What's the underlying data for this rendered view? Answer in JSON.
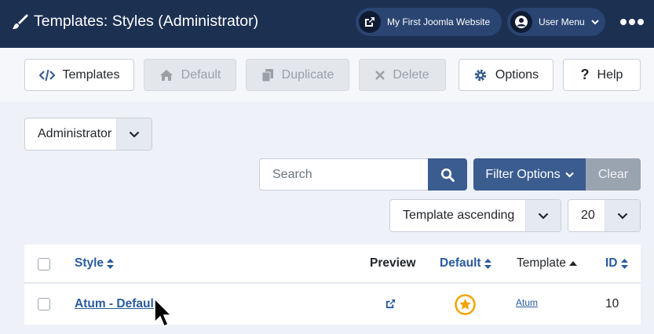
{
  "header": {
    "title": "Templates: Styles (Administrator)",
    "site_link": "My First Joomla Website",
    "user_menu": "User Menu"
  },
  "toolbar": {
    "templates": "Templates",
    "default": "Default",
    "duplicate": "Duplicate",
    "delete": "Delete",
    "options": "Options",
    "help": "Help"
  },
  "filters": {
    "client": "Administrator",
    "search_placeholder": "Search",
    "filter_options": "Filter Options",
    "clear": "Clear",
    "ordering": "Template ascending",
    "limit": "20"
  },
  "table": {
    "columns": {
      "style": "Style",
      "preview": "Preview",
      "default": "Default",
      "template": "Template",
      "id": "ID"
    },
    "rows": [
      {
        "style": "Atum - Default",
        "template": "Atum",
        "id": "10"
      }
    ]
  },
  "colors": {
    "header_bg": "#1c3052",
    "primary": "#3a5c8f",
    "link": "#2a5b9e",
    "star": "#f0a500"
  }
}
